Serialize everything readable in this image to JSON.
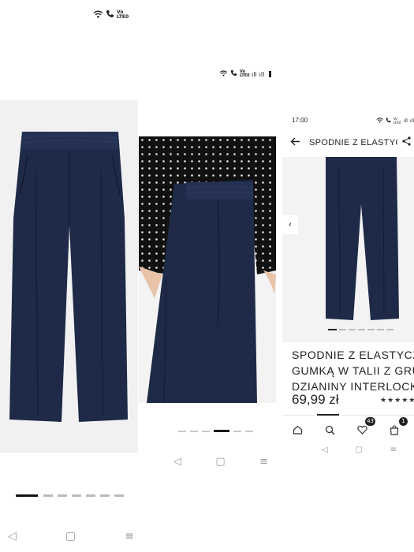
{
  "screenshot_top": {
    "status": {
      "wifi": "wifi-icon",
      "call": "call-icon",
      "volte": "Vo LTE0"
    }
  },
  "screenshot_mid": {
    "status": {
      "volte": "Vo LTE0",
      "signal1": "ıll",
      "signal2": "ıll"
    },
    "carousel_dots": 6,
    "active_dot": 4
  },
  "phone": {
    "status": {
      "time": "17:00",
      "volte": "Vo LTE0"
    },
    "header": {
      "title": "SPODNIE Z ELASTYCZ..."
    },
    "image_dots": 7,
    "active_dot": 0,
    "product": {
      "name_line1": "SPODNIE Z ELASTYCZNĄ",
      "name_line2": "GUMKĄ W TALII Z GRUB",
      "name_line3": "DZIANINY INTERLOCK",
      "price": "69,99 zł",
      "stars": "★★★★★"
    },
    "bottom_nav": {
      "wishlist_count": "43",
      "cart_count": "1"
    }
  },
  "bottom_dots": {
    "count": 7,
    "active": 0
  },
  "colors": {
    "navy": "#1e2a48",
    "blouse": "#111111"
  }
}
